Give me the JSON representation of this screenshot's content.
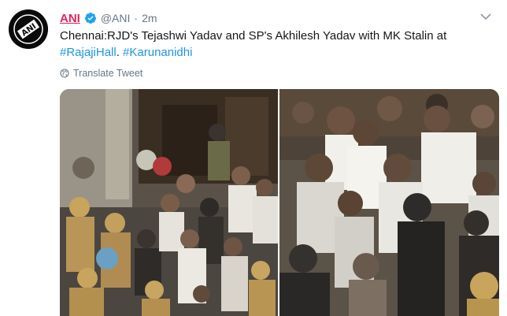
{
  "tweet": {
    "author_name": "ANI",
    "handle": "@ANI",
    "separator": "·",
    "time": "2m",
    "text_main": "Chennai:RJD's Tejashwi Yadav and SP's Akhilesh Yadav with MK Stalin at",
    "hashtag_1": "#RajajiHall",
    "text_between": ". ",
    "hashtag_2": "#Karunanidhi",
    "translate_label": "Translate Tweet",
    "avatar_text": "ANI"
  },
  "icons": {
    "verified": "verified-badge-icon",
    "globe": "globe-icon",
    "caret": "chevron-down-icon"
  },
  "colors": {
    "name": "#e0245e",
    "hashtag": "#1b95e0",
    "verified": "#1da1f2",
    "muted": "#657786"
  }
}
